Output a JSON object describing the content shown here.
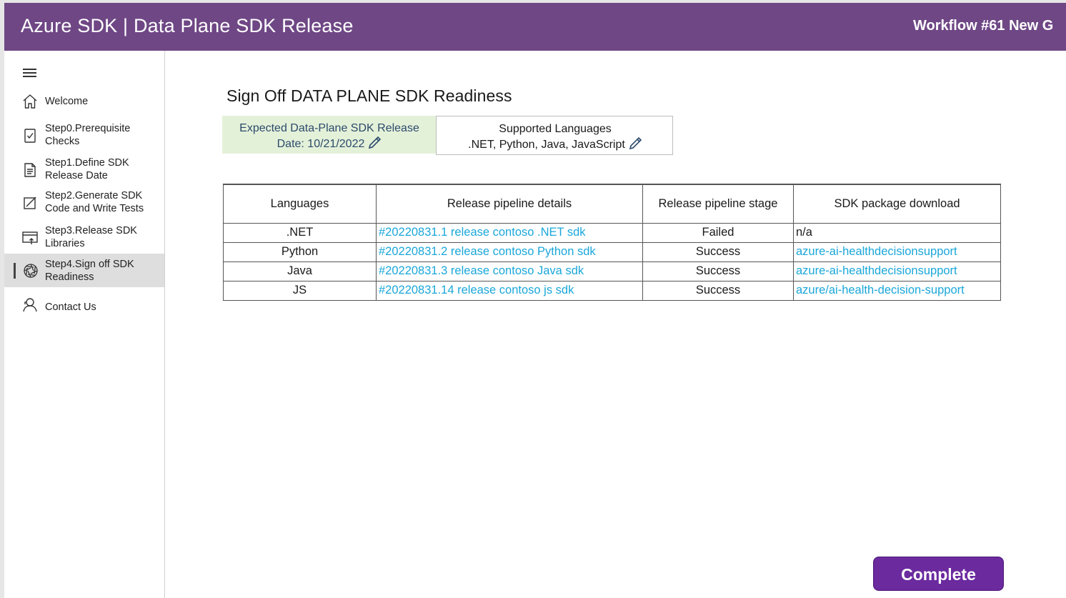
{
  "header": {
    "title": "Azure SDK | Data Plane SDK Release",
    "workflow": "Workflow #61 New G"
  },
  "sidebar": {
    "items": [
      {
        "label": "Welcome",
        "icon": "home-icon"
      },
      {
        "label": "Step0.Prerequisite\nChecks",
        "icon": "checklist-icon"
      },
      {
        "label": "Step1.Define SDK\nRelease Date",
        "icon": "document-icon"
      },
      {
        "label": "Step2.Generate SDK\nCode and Write Tests",
        "icon": "edit-square-icon"
      },
      {
        "label": "Step3.Release SDK\nLibraries",
        "icon": "release-icon"
      },
      {
        "label": "Step4.Sign off SDK\nReadiness",
        "icon": "aperture-icon"
      },
      {
        "label": "Contact Us",
        "icon": "contact-icon"
      }
    ],
    "active_index": 5
  },
  "main": {
    "title": "Sign Off DATA PLANE SDK Readiness",
    "release_date": {
      "line1": "Expected Data-Plane SDK Release",
      "line2": "Date: 10/21/2022"
    },
    "languages_card": {
      "line1": "Supported Languages",
      "line2": ".NET, Python, Java, JavaScript"
    },
    "table": {
      "headers": [
        "Languages",
        "Release pipeline details",
        "Release pipeline stage",
        "SDK package download"
      ],
      "rows": [
        {
          "language": ".NET",
          "pipeline": "#20220831.1 release contoso .NET sdk",
          "stage": "Failed",
          "package": "n/a"
        },
        {
          "language": "Python",
          "pipeline": "#20220831.2 release contoso Python sdk",
          "stage": "Success",
          "package": "azure-ai-healthdecisionsupport"
        },
        {
          "language": "Java",
          "pipeline": "#20220831.3 release contoso Java sdk",
          "stage": "Success",
          "package": "azure-ai-healthdecisionsupport"
        },
        {
          "language": "JS",
          "pipeline": "#20220831.14 release contoso js sdk",
          "stage": "Success",
          "package": "azure/ai-health-decision-support"
        }
      ]
    },
    "complete_label": "Complete"
  },
  "colors": {
    "header_bg": "#6f4785",
    "link": "#1aa7d9",
    "button_bg": "#6b2a9e",
    "date_card_bg": "#e4f1d9"
  }
}
